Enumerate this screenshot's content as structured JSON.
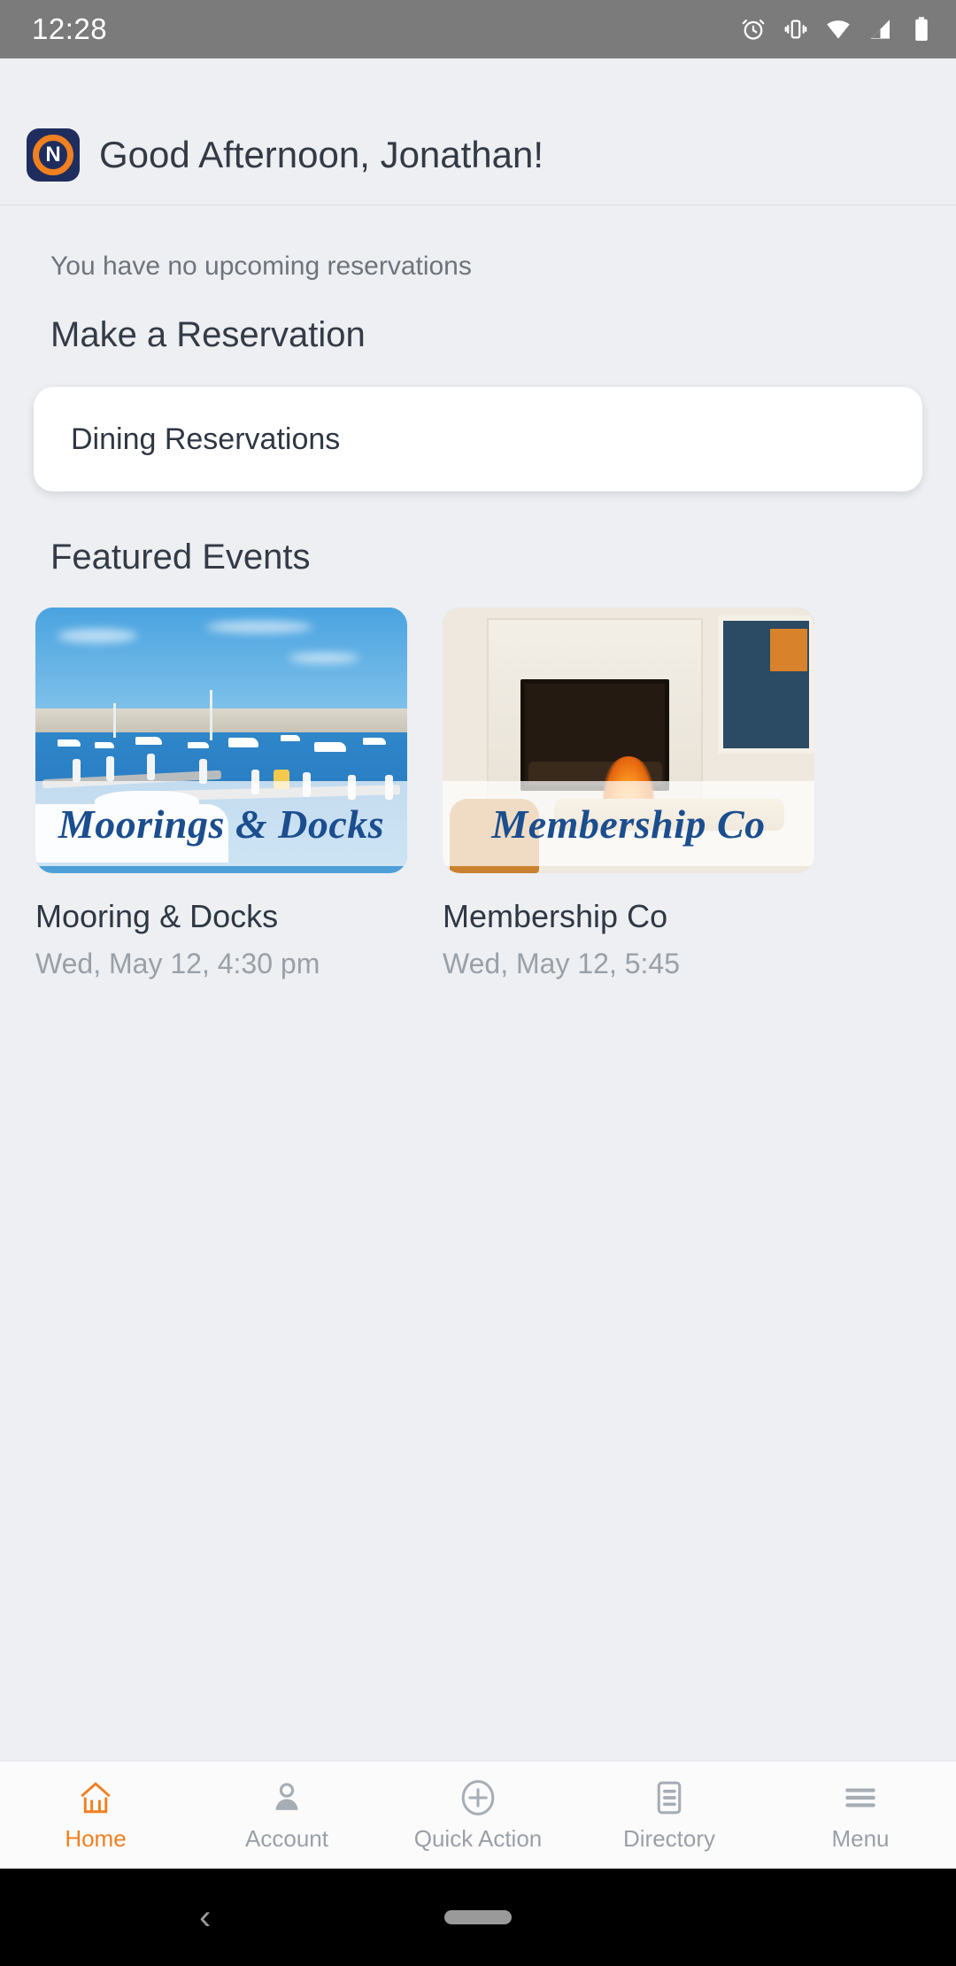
{
  "status_bar": {
    "time": "12:28",
    "icons": [
      "alarm-icon",
      "vibrate-icon",
      "wifi-icon",
      "signal-icon",
      "battery-icon"
    ]
  },
  "header": {
    "logo_letter": "N",
    "greeting": "Good Afternoon, Jonathan!"
  },
  "main": {
    "no_reservations": "You have no upcoming reservations",
    "make_reservation_title": "Make a Reservation",
    "reservation_options": [
      {
        "label": "Dining Reservations"
      }
    ],
    "featured_title": "Featured Events",
    "events": [
      {
        "banner": "Moorings & Docks",
        "name": "Mooring & Docks",
        "date": "Wed, May 12, 4:30 pm",
        "image": "harbor-marina-photo"
      },
      {
        "banner": "Membership Co",
        "name": "Membership Co",
        "date": "Wed, May 12, 5:45",
        "image": "fireplace-lounge-photo"
      }
    ]
  },
  "tabbar": {
    "items": [
      {
        "label": "Home",
        "icon": "home-icon",
        "active": true
      },
      {
        "label": "Account",
        "icon": "person-icon",
        "active": false
      },
      {
        "label": "Quick Action",
        "icon": "plus-circle-icon",
        "active": false
      },
      {
        "label": "Directory",
        "icon": "list-document-icon",
        "active": false
      },
      {
        "label": "Menu",
        "icon": "hamburger-icon",
        "active": false
      }
    ]
  },
  "android_nav": {
    "back": "‹"
  },
  "colors": {
    "accent": "#f08020",
    "brand_navy": "#1f2d5e",
    "page_bg": "#edeff2",
    "text_primary": "#2f3744",
    "text_muted": "#9aa0a8"
  }
}
